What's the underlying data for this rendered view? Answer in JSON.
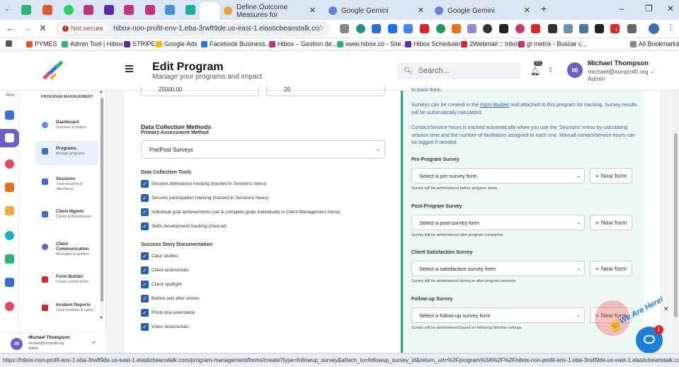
{
  "browser": {
    "tabs": [
      {
        "label": "Define Outcome Measures for",
        "color": "#e8a33a"
      },
      {
        "label": "Google Gemini",
        "color": "#6b7ee0"
      },
      {
        "label": "Google Gemini",
        "color": "#6b7ee0"
      }
    ],
    "not_secure": "Not secure",
    "url": "hibox-non-profit-env-1.eba-3rwft9de.us-east-1.elasticbeanstalk.com...",
    "bookmarks": [
      "PYMES",
      "Admin Tool | Hibox |",
      "STRIPE",
      "Google Ads",
      "Facebook Business...",
      "Hibox – Gestion de...",
      "www.hibox.co - Site...",
      "Hibox Scheduler",
      "2Webmail :: Inbox",
      "gt metrix - Buscar c...",
      "All Bookmarks"
    ],
    "ext_badge": "1",
    "status_url": "https://hibox-non-profit-env-1.eba-3rwft9de.us-east-1.elasticbeanstalk.com/program-management/forms/create?type=followup_survey&attach_to=followup_survey_id&return_url=%2Fprogram%3A%2F%2Fhibox-non-profit-env-1.eba-3rwft9de.us-east-1.elasticbeanstalk.com%2F..."
  },
  "header": {
    "title": "Edit Program",
    "subtitle": "Manage your programs and impact",
    "search_placeholder": "Search...",
    "notif_count": "21",
    "user": {
      "initials": "MI",
      "name": "Michael Thompson",
      "email": "michael@nonprofit.org",
      "role": "Admin"
    }
  },
  "sidebar": {
    "rail_label": "MAIN",
    "section": "PROGRAM MANAGEMENT",
    "items": [
      {
        "title": "Dashboard",
        "sub": "Overview & metrics",
        "color": "#5b8de0"
      },
      {
        "title": "Programs",
        "sub": "Manage programs",
        "color": "#3c6fc4"
      },
      {
        "title": "Sessions",
        "sub": "Track sessions & attendance",
        "color": "#3c6fc4"
      },
      {
        "title": "Client Mgmnt",
        "sub": "Clients & Beneficiaries",
        "color": "#3c6fc4"
      },
      {
        "title": "Client Communication",
        "sub": "Messages & updates",
        "color": "#6b5fc7"
      },
      {
        "title": "Form Builder",
        "sub": "Create custom forms",
        "color": "#d9262c"
      },
      {
        "title": "Incident Reports",
        "sub": "Track incidents & safety",
        "color": "#d9262c"
      }
    ],
    "footer": {
      "initials": "MI",
      "name": "Michael Thompson",
      "email": "michael@nonprofit.org",
      "role": "Admin"
    }
  },
  "form": {
    "top_inputs": [
      "25000.00",
      "20"
    ],
    "dcm_title": "Data Collection Methods",
    "primary_label": "Primary Assessment Method",
    "primary_value": "Pre/Post Surveys",
    "tools_label": "Data Collection Tools",
    "tools": [
      "Session attendance tracking (tracked in Sessions menu)",
      "Session participation tracking (tracked in Sessions menu)",
      "Individual goal achievements (set & complete goals individually in Client Management menu)",
      "Skills development tracking (manual)"
    ],
    "story_label": "Success Story Documentation",
    "stories": [
      "Case studies",
      "Client testimonials",
      "Client spotlight",
      "Before and after stories",
      "Photo documentation",
      "Video testimonials"
    ]
  },
  "survey_panel": {
    "intro_top": "to track them.",
    "intro_p1_a": "Surveys can be created in the ",
    "intro_p1_link": "Form Builder",
    "intro_p1_b": " and attached to this program for tracking. Survey results will be automatically calculated.",
    "intro_p2": "Contact/Service hours is tracked automatically when you use the 'Sessions' menu by calculating session time and the number of facilitators assigned to each one. Manual contact/service hours can be logged if needed.",
    "new_form": "New form",
    "surveys": [
      {
        "label": "Pre-Program Survey",
        "placeholder": "Select a pre-survey form",
        "hint": "Survey will be administered before program starts"
      },
      {
        "label": "Post-Program Survey",
        "placeholder": "Select a post-survey form",
        "hint": "Survey will be administered after program completion"
      },
      {
        "label": "Client Satisfaction Survey",
        "placeholder": "Select a satisfaction survey form",
        "hint": "Survey will be administered during or after program sessions"
      },
      {
        "label": "Follow-up Survey",
        "placeholder": "Select a follow-up survey form",
        "hint": "Survey will be administered based on follow-up timeline settings"
      }
    ]
  },
  "chat": {
    "teaser": "We Are Here!",
    "badge": "1"
  }
}
